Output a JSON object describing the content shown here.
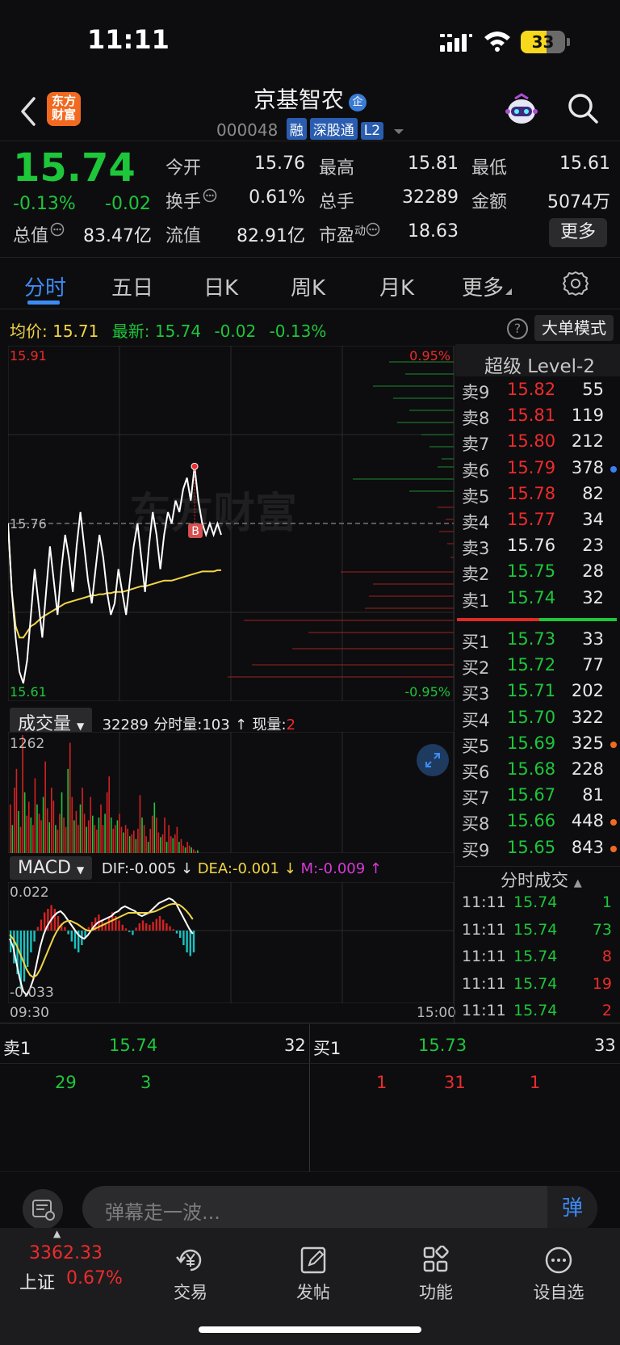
{
  "status_bar": {
    "time": "11:11",
    "battery": "33"
  },
  "header": {
    "logo_text": "东方财富",
    "stock_name": "京基智农",
    "badge_qi": "企",
    "stock_code": "000048",
    "tags": [
      "融",
      "深股通",
      "L2"
    ]
  },
  "quote": {
    "price": "15.74",
    "change_pct": "-0.13%",
    "change": "-0.02",
    "fields": [
      {
        "label": "今开",
        "value": "15.76",
        "color": "white"
      },
      {
        "label": "最高",
        "value": "15.81",
        "color": "red"
      },
      {
        "label": "最低",
        "value": "15.61",
        "color": "green"
      },
      {
        "label": "换手",
        "value": "0.61%",
        "color": "white"
      },
      {
        "label": "总手",
        "value": "32289",
        "color": "white"
      },
      {
        "label": "金额",
        "value": "5074万",
        "color": "white"
      },
      {
        "label": "总值",
        "value": "83.47亿",
        "color": "white"
      },
      {
        "label": "流值",
        "value": "82.91亿",
        "color": "white"
      },
      {
        "label": "市盈",
        "value": "18.63",
        "color": "white",
        "sup": "动"
      }
    ],
    "more_label": "更多"
  },
  "tabs": [
    "分时",
    "五日",
    "日K",
    "周K",
    "月K",
    "更多"
  ],
  "active_tab": "分时",
  "chart_info": {
    "avg_label": "均价:",
    "avg_value": "15.71",
    "latest_label": "最新:",
    "latest_value": "15.74",
    "latest_change": "-0.02",
    "latest_pct": "-0.13%",
    "help": "?",
    "big_order_mode": "大单模式",
    "watermark": "东方财富",
    "buy_marker": "B"
  },
  "chart_data": [
    {
      "type": "line",
      "title": "",
      "y_ticks": [
        "15.91",
        "15.76",
        "15.61"
      ],
      "right_ticks": [
        "0.95%",
        "-0.95%"
      ],
      "x_ticks": [
        "09:30",
        "15:00"
      ],
      "ylim": [
        15.61,
        15.91
      ],
      "prev_close": 15.76,
      "series": [
        {
          "name": "price",
          "color": "#ffffff",
          "values": [
            15.76,
            15.7,
            15.66,
            15.63,
            15.62,
            15.64,
            15.68,
            15.72,
            15.69,
            15.66,
            15.7,
            15.74,
            15.71,
            15.68,
            15.72,
            15.75,
            15.73,
            15.7,
            15.74,
            15.77,
            15.74,
            15.71,
            15.69,
            15.72,
            15.75,
            15.73,
            15.7,
            15.68,
            15.69,
            15.72,
            15.7,
            15.68,
            15.71,
            15.74,
            15.76,
            15.73,
            15.7,
            15.74,
            15.77,
            15.75,
            15.72,
            15.75,
            15.77,
            15.76,
            15.78,
            15.77,
            15.79,
            15.8,
            15.78,
            15.81,
            15.78,
            15.76,
            15.75,
            15.76,
            15.75,
            15.76,
            15.75
          ]
        },
        {
          "name": "average",
          "color": "#f1d545",
          "values": [
            15.76,
            15.7,
            15.67,
            15.66,
            15.66,
            15.665,
            15.67,
            15.672,
            15.675,
            15.678,
            15.68,
            15.682,
            15.684,
            15.686,
            15.688,
            15.69,
            15.691,
            15.692,
            15.693,
            15.694,
            15.695,
            15.696,
            15.697,
            15.697,
            15.698,
            15.698,
            15.699,
            15.699,
            15.7,
            15.7,
            15.7,
            15.701,
            15.702,
            15.703,
            15.704,
            15.705,
            15.705,
            15.706,
            15.707,
            15.708,
            15.709,
            15.71,
            15.71,
            15.71,
            15.711,
            15.712,
            15.713,
            15.714,
            15.715,
            15.716,
            15.717,
            15.718,
            15.718,
            15.718,
            15.718,
            15.719,
            15.719
          ]
        }
      ]
    },
    {
      "type": "bar",
      "title": "成交量",
      "total": "32289",
      "minute_label": "分时量:",
      "minute_value": "103",
      "current_label": "现量:",
      "current_value": "2",
      "y_max_tick": "1262",
      "ylim": [
        0,
        1262
      ]
    },
    {
      "type": "bar",
      "title": "MACD",
      "dif_label": "DIF:",
      "dif": "-0.005",
      "dea_label": "DEA:",
      "dea": "-0.001",
      "m_label": "M:",
      "m": "-0.009",
      "y_ticks": [
        "0.022",
        "-0.033"
      ],
      "ylim": [
        -0.033,
        0.022
      ]
    }
  ],
  "order_book": {
    "title": "超级 Level-2",
    "asks": [
      {
        "label": "卖9",
        "price": "15.82",
        "vol": "55",
        "color": "red"
      },
      {
        "label": "卖8",
        "price": "15.81",
        "vol": "119",
        "color": "red"
      },
      {
        "label": "卖7",
        "price": "15.80",
        "vol": "212",
        "color": "red"
      },
      {
        "label": "卖6",
        "price": "15.79",
        "vol": "378",
        "color": "red",
        "dot": "#3d7ff0"
      },
      {
        "label": "卖5",
        "price": "15.78",
        "vol": "82",
        "color": "red"
      },
      {
        "label": "卖4",
        "price": "15.77",
        "vol": "34",
        "color": "red"
      },
      {
        "label": "卖3",
        "price": "15.76",
        "vol": "23",
        "color": "white"
      },
      {
        "label": "卖2",
        "price": "15.75",
        "vol": "28",
        "color": "green"
      },
      {
        "label": "卖1",
        "price": "15.74",
        "vol": "32",
        "color": "green"
      }
    ],
    "bids": [
      {
        "label": "买1",
        "price": "15.73",
        "vol": "33",
        "color": "green"
      },
      {
        "label": "买2",
        "price": "15.72",
        "vol": "77",
        "color": "green"
      },
      {
        "label": "买3",
        "price": "15.71",
        "vol": "202",
        "color": "green"
      },
      {
        "label": "买4",
        "price": "15.70",
        "vol": "322",
        "color": "green"
      },
      {
        "label": "买5",
        "price": "15.69",
        "vol": "325",
        "color": "green",
        "dot": "#f26a21"
      },
      {
        "label": "买6",
        "price": "15.68",
        "vol": "228",
        "color": "green"
      },
      {
        "label": "买7",
        "price": "15.67",
        "vol": "81",
        "color": "green"
      },
      {
        "label": "买8",
        "price": "15.66",
        "vol": "448",
        "color": "green",
        "dot": "#f26a21"
      },
      {
        "label": "买9",
        "price": "15.65",
        "vol": "843",
        "color": "green",
        "dot": "#f26a21"
      }
    ]
  },
  "ticks": {
    "title": "分时成交",
    "rows": [
      {
        "time": "11:11",
        "price": "15.74",
        "vol": "1",
        "color": "green"
      },
      {
        "time": "11:11",
        "price": "15.74",
        "vol": "73",
        "color": "green"
      },
      {
        "time": "11:11",
        "price": "15.74",
        "vol": "8",
        "color": "red"
      },
      {
        "time": "11:11",
        "price": "15.74",
        "vol": "19",
        "color": "red"
      },
      {
        "time": "11:11",
        "price": "15.74",
        "vol": "2",
        "color": "red"
      }
    ]
  },
  "bottom_book": {
    "sell": {
      "label": "卖1",
      "price": "15.74",
      "vol": "32",
      "details": [
        "29",
        "3"
      ]
    },
    "buy": {
      "label": "买1",
      "price": "15.73",
      "vol": "33",
      "details": [
        "1",
        "31",
        "1"
      ]
    }
  },
  "danmu": {
    "placeholder": "弹幕走一波...",
    "button": "弹"
  },
  "bottom_nav": {
    "index_value": "3362.33",
    "index_name": "上证",
    "index_pct": "0.67%",
    "items": [
      "交易",
      "发帖",
      "功能",
      "设自选"
    ]
  }
}
